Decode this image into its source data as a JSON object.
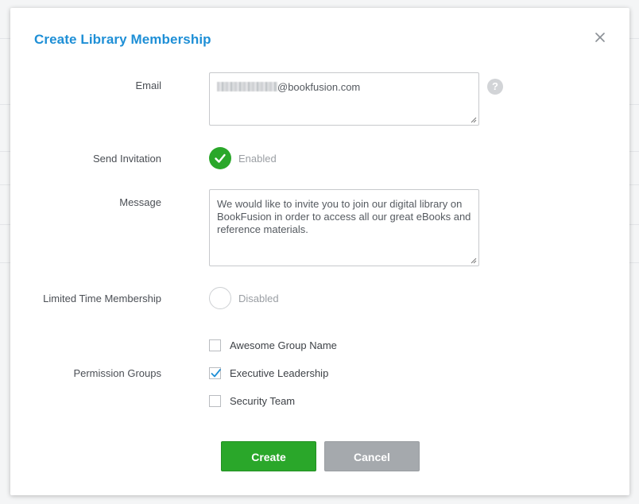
{
  "modal": {
    "title": "Create Library Membership"
  },
  "fields": {
    "email": {
      "label": "Email",
      "value_suffix": "@bookfusion.com",
      "help": "?"
    },
    "send_invitation": {
      "label": "Send Invitation",
      "state": "Enabled",
      "checked": true
    },
    "message": {
      "label": "Message",
      "value": "We would like to invite you to join our digital library on BookFusion in order to access all our great eBooks and reference materials."
    },
    "limited_time": {
      "label": "Limited Time Membership",
      "state": "Disabled",
      "checked": false
    },
    "permission_groups": {
      "label": "Permission Groups",
      "options": [
        {
          "label": "Awesome Group Name",
          "checked": false
        },
        {
          "label": "Executive Leadership",
          "checked": true
        },
        {
          "label": "Security Team",
          "checked": false
        }
      ]
    }
  },
  "actions": {
    "create": "Create",
    "cancel": "Cancel"
  },
  "colors": {
    "accent": "#1e8fd6",
    "success": "#2aa72a",
    "muted_button": "#a5a9ad"
  },
  "icons": {
    "close": "close-icon",
    "help": "help-icon",
    "check": "checkmark-icon",
    "resize": "resize-grip-icon"
  }
}
